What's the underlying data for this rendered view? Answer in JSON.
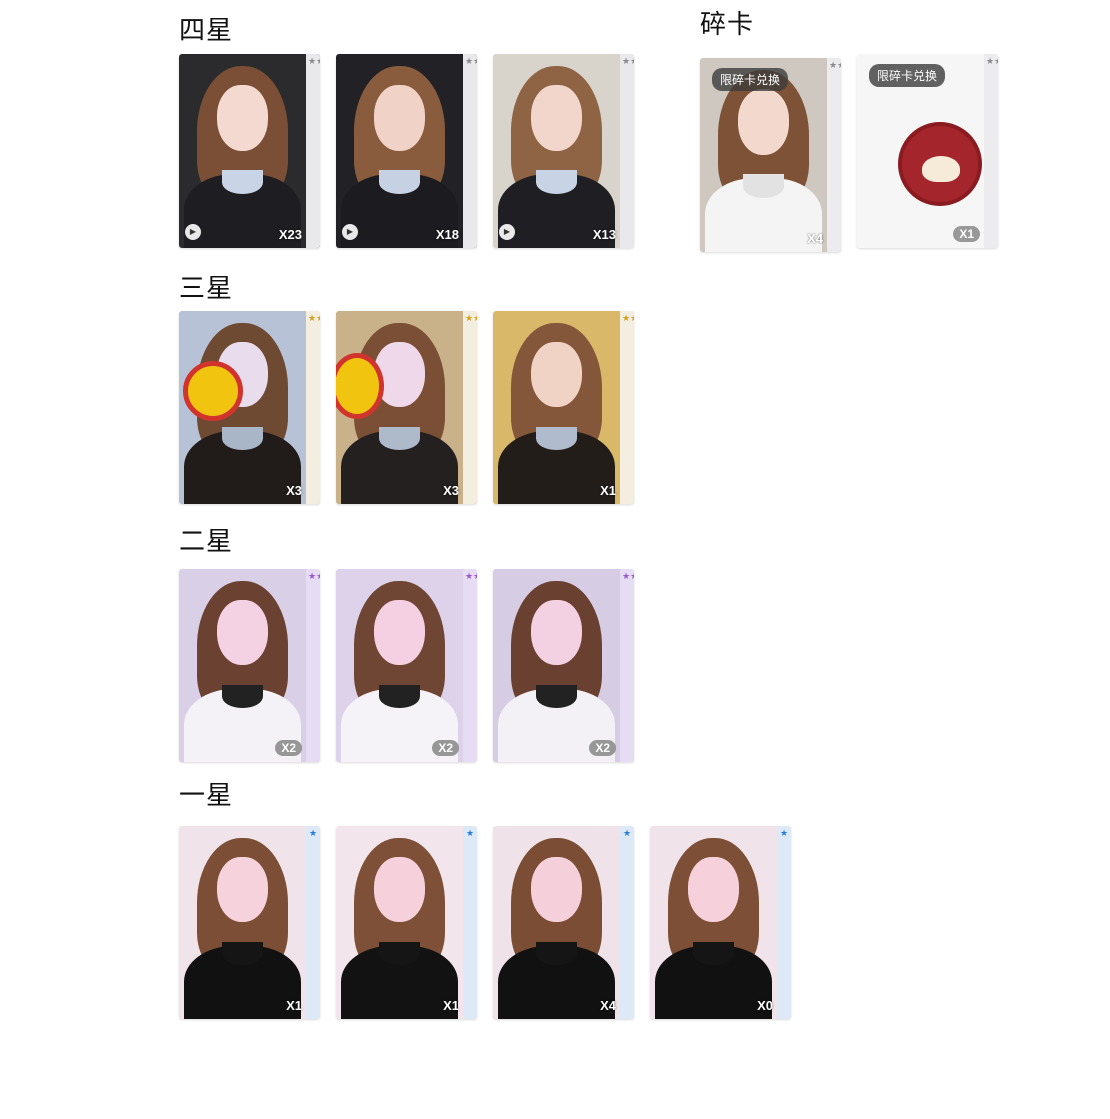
{
  "sections": {
    "four_star": {
      "title": "四星",
      "cards": [
        {
          "count": "X23",
          "stars": "★★★★",
          "icon": "play-icon"
        },
        {
          "count": "X18",
          "stars": "★★★★",
          "icon": "play-icon"
        },
        {
          "count": "X13",
          "stars": "★★★★",
          "icon": "play-icon"
        }
      ]
    },
    "fragment": {
      "title": "碎卡",
      "cards": [
        {
          "count": "X4",
          "stars": "★★★★",
          "badge": "限碎卡兑换"
        },
        {
          "count": "X1",
          "stars": "★★★★",
          "badge": "限碎卡兑换"
        }
      ]
    },
    "three_star": {
      "title": "三星",
      "cards": [
        {
          "count": "X3",
          "stars": "★★★"
        },
        {
          "count": "X3",
          "stars": "★★★"
        },
        {
          "count": "X1",
          "stars": "★★★"
        }
      ]
    },
    "two_star": {
      "title": "二星",
      "cards": [
        {
          "count": "X2",
          "stars": "★★"
        },
        {
          "count": "X2",
          "stars": "★★"
        },
        {
          "count": "X2",
          "stars": "★★"
        }
      ]
    },
    "one_star": {
      "title": "一星",
      "cards": [
        {
          "count": "X1",
          "stars": "★"
        },
        {
          "count": "X1",
          "stars": "★"
        },
        {
          "count": "X4",
          "stars": "★"
        },
        {
          "count": "X0",
          "stars": "★"
        }
      ]
    }
  },
  "colors": {
    "four_star_bg": "#2b2b2e",
    "three_star_bg": "#c9b28a",
    "two_star_bg": "#d9cfe6",
    "one_star_bg": "#f1e3ea",
    "hair": "#7a4f35",
    "skin": "#f3d9cf",
    "star_gray": "#8a8a8a",
    "star_gold": "#d4a21b",
    "star_purple": "#9b59d0",
    "star_blue": "#2a7fd4"
  }
}
